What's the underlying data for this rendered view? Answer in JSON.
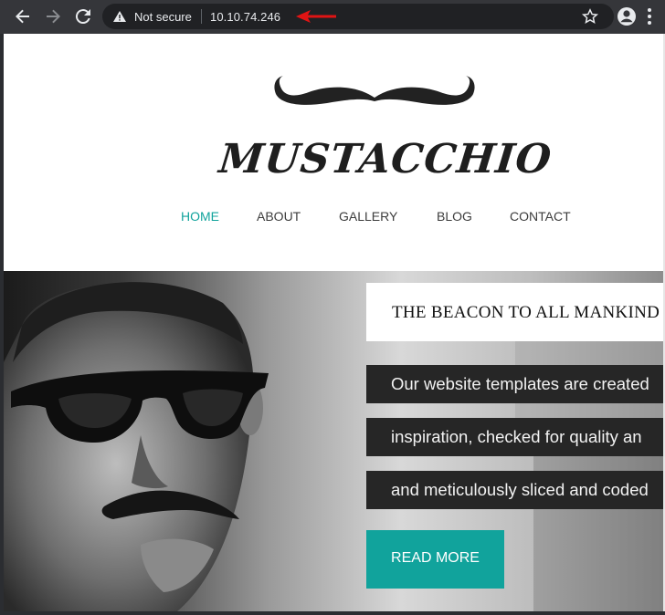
{
  "browser": {
    "security_label": "Not secure",
    "url": "10.10.74.246"
  },
  "site": {
    "brand": "MUSTACCHIO",
    "nav": {
      "home": "HOME",
      "about": "ABOUT",
      "gallery": "GALLERY",
      "blog": "BLOG",
      "contact": "CONTACT"
    },
    "nav_active": "HOME",
    "colors": {
      "accent": "#11a39c",
      "dark_box": "#262626"
    },
    "hero": {
      "headline": "THE BEACON TO ALL MANKIND",
      "lines": [
        "Our website templates are created",
        "inspiration, checked for quality an",
        "and meticulously sliced and coded"
      ],
      "button": "READ MORE"
    }
  },
  "icons": {
    "back": "back-arrow-icon",
    "forward": "forward-arrow-icon",
    "reload": "reload-icon",
    "warning": "warning-icon",
    "annotation": "red-arrow-icon",
    "bookmark": "star-icon",
    "profile": "profile-icon",
    "menu": "kebab-menu-icon"
  }
}
